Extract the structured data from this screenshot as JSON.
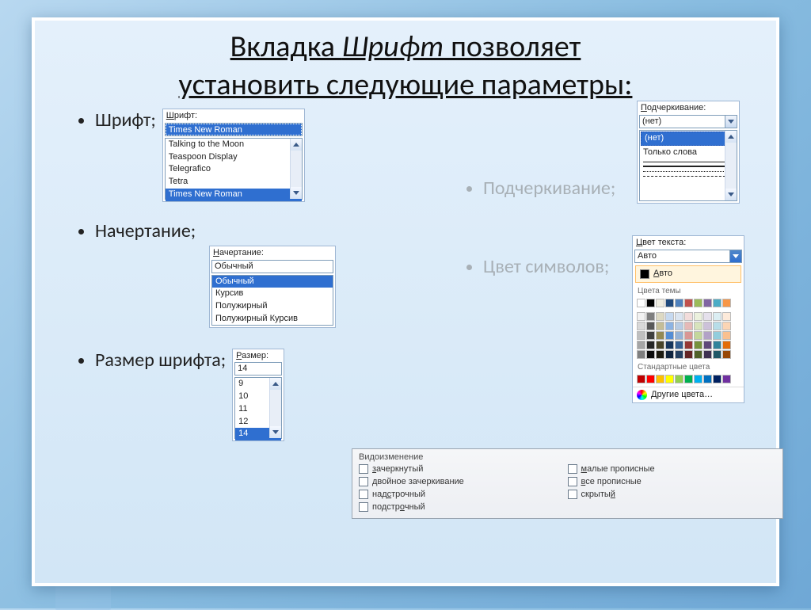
{
  "title_parts": {
    "a": "Вкладка ",
    "b": "Шрифт",
    "c": " позволяет",
    "d": "установить следующие параметры:"
  },
  "left_bullets": [
    "Шрифт;",
    "Начертание;",
    "Размер шрифта;"
  ],
  "right_bullets": [
    "Подчеркивание;",
    "Цвет символов;"
  ],
  "font_panel": {
    "label_ul": "Ш",
    "label_rest": "рифт:",
    "selected": "Times New Roman",
    "options": [
      "Talking to the Moon",
      "Teaspoon Display",
      "Telegrafico",
      "Tetra",
      "Times New Roman"
    ],
    "highlighted_index": 4
  },
  "style_panel": {
    "label_ul": "Н",
    "label_rest": "ачертание:",
    "selected": "Обычный",
    "options": [
      "Обычный",
      "Курсив",
      "Полужирный",
      "Полужирный Курсив"
    ],
    "highlighted_index": 0
  },
  "size_panel": {
    "label_ul": "Р",
    "label_rest": "азмер:",
    "selected": "14",
    "options": [
      "9",
      "10",
      "11",
      "12",
      "14"
    ],
    "highlighted_index": 4
  },
  "underline_panel": {
    "label_ul": "П",
    "label_rest": "одчеркивание:",
    "selected": "(нет)",
    "text_top": "(нет)",
    "text_words": "Только слова"
  },
  "color_panel": {
    "label_ul": "Ц",
    "label_rest": "вет текста:",
    "selected": "Авто",
    "auto_ul": "А",
    "auto_rest": "вто",
    "section_theme": "Цвета темы",
    "section_std": "Стандартные цвета",
    "more_ul": "Д",
    "more_rest": "ругие цвета…",
    "theme_row1": [
      "#ffffff",
      "#000000",
      "#eeece1",
      "#1f497d",
      "#4f81bd",
      "#c0504d",
      "#9bbb59",
      "#8064a2",
      "#4bacc6",
      "#f79646"
    ],
    "theme_grid": [
      "#f2f2f2",
      "#7f7f7f",
      "#ddd9c3",
      "#c6d9f0",
      "#dbe5f1",
      "#f2dcdb",
      "#ebf1dd",
      "#e5e0ec",
      "#dbeef3",
      "#fdeada",
      "#d8d8d8",
      "#595959",
      "#c4bd97",
      "#8db3e2",
      "#b8cce4",
      "#e5b9b7",
      "#d7e3bc",
      "#ccc1d9",
      "#b7dde8",
      "#fbd5b5",
      "#bfbfbf",
      "#3f3f3f",
      "#938953",
      "#548dd4",
      "#95b3d7",
      "#d99694",
      "#c3d69b",
      "#b2a2c7",
      "#92cddc",
      "#fac08f",
      "#a5a5a5",
      "#262626",
      "#494429",
      "#17365d",
      "#366092",
      "#953734",
      "#76923c",
      "#5f497a",
      "#31849b",
      "#e36c09",
      "#7f7f7f",
      "#0c0c0c",
      "#1d1b10",
      "#0f243e",
      "#244061",
      "#632423",
      "#4f6128",
      "#3f3151",
      "#205867",
      "#974806"
    ],
    "std": [
      "#c00000",
      "#ff0000",
      "#ffc000",
      "#ffff00",
      "#92d050",
      "#00b050",
      "#00b0f0",
      "#0070c0",
      "#002060",
      "#7030a0"
    ]
  },
  "effects_panel": {
    "title": "Видоизменение",
    "col1": [
      {
        "ul": "з",
        "rest": "ачеркнутый"
      },
      {
        "ul": "",
        "rest": "двойное зачеркивание"
      },
      {
        "ul": "",
        "rest": "над",
        "ul2": "с",
        "rest2": "трочный"
      },
      {
        "ul": "",
        "rest": "подстр",
        "ul2": "о",
        "rest2": "чный"
      }
    ],
    "col2": [
      {
        "ul": "м",
        "rest": "алые прописные"
      },
      {
        "ul": "в",
        "rest": "се прописные"
      },
      {
        "ul": "",
        "rest": "скрыты",
        "ul2": "й",
        "rest2": ""
      }
    ]
  }
}
